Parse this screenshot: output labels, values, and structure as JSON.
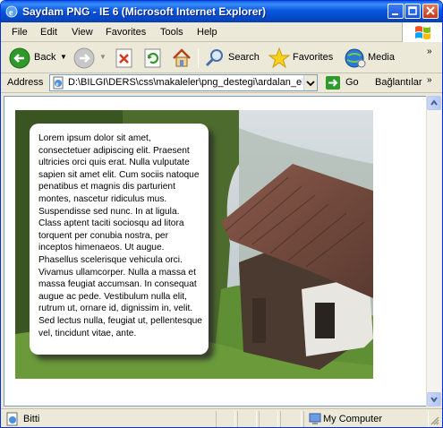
{
  "window": {
    "title": "Saydam PNG - IE 6 (Microsoft Internet Explorer)"
  },
  "menu": {
    "items": [
      {
        "label": "File"
      },
      {
        "label": "Edit"
      },
      {
        "label": "View"
      },
      {
        "label": "Favorites"
      },
      {
        "label": "Tools"
      },
      {
        "label": "Help"
      }
    ]
  },
  "toolbar": {
    "back_label": "Back",
    "search_label": "Search",
    "favorites_label": "Favorites",
    "media_label": "Media"
  },
  "address": {
    "label": "Address",
    "value": "D:\\BILGI\\DERS\\css\\makaleler\\png_destegi\\ardalan_ekl",
    "go_label": "Go",
    "links_label": "Bağlantılar"
  },
  "page": {
    "paragraph": "Lorem ipsum dolor sit amet, consectetuer adipiscing elit. Praesent ultricies orci quis erat. Nulla vulputate sapien sit amet elit. Cum sociis natoque penatibus et magnis dis parturient montes, nascetur ridiculus mus. Suspendisse sed nunc. In at ligula. Class aptent taciti sociosqu ad litora torquent per conubia nostra, per inceptos himenaeos. Ut augue. Phasellus scelerisque vehicula orci. Vivamus ullamcorper. Nulla a massa et massa feugiat accumsan. In consequat augue ac pede. Vestibulum nulla elit, rutrum ut, ornare id, dignissim in, velit. Sed lectus nulla, feugiat ut, pellentesque vel, tincidunt vitae, ante."
  },
  "status": {
    "text": "Bitti",
    "zone": "My Computer"
  },
  "icons": {
    "app": "ie-icon",
    "back": "back-arrow-icon",
    "forward": "forward-arrow-icon",
    "stop": "stop-icon",
    "refresh": "refresh-icon",
    "home": "home-icon",
    "search": "search-icon",
    "favorites": "favorites-star-icon",
    "media": "media-icon"
  },
  "colors": {
    "titlebar": "#0857e0",
    "window_bg": "#ece9d8"
  }
}
